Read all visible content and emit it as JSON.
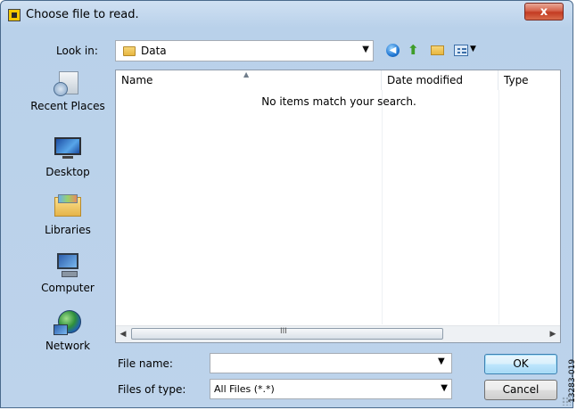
{
  "window": {
    "title": "Choose file to read.",
    "close_label": "x",
    "icon": "labview-app-icon"
  },
  "toolbar": {
    "look_in_label": "Look in:",
    "look_in_value": "Data",
    "icons": [
      "back-icon",
      "up-folder-icon",
      "new-folder-icon",
      "views-menu-icon"
    ]
  },
  "places": [
    {
      "label": "Recent Places",
      "icon": "recent-places-icon"
    },
    {
      "label": "Desktop",
      "icon": "desktop-icon"
    },
    {
      "label": "Libraries",
      "icon": "libraries-icon"
    },
    {
      "label": "Computer",
      "icon": "computer-icon"
    },
    {
      "label": "Network",
      "icon": "network-icon"
    }
  ],
  "file_list": {
    "columns": [
      "Name",
      "Date modified",
      "Type"
    ],
    "empty_message": "No items match your search.",
    "scrollbar_grip": "III"
  },
  "footer": {
    "file_name_label": "File name:",
    "file_name_value": "",
    "files_of_type_label": "Files of type:",
    "files_of_type_value": "All Files (*.*)",
    "ok_label": "OK",
    "cancel_label": "Cancel"
  },
  "figure_code": "13283-019"
}
